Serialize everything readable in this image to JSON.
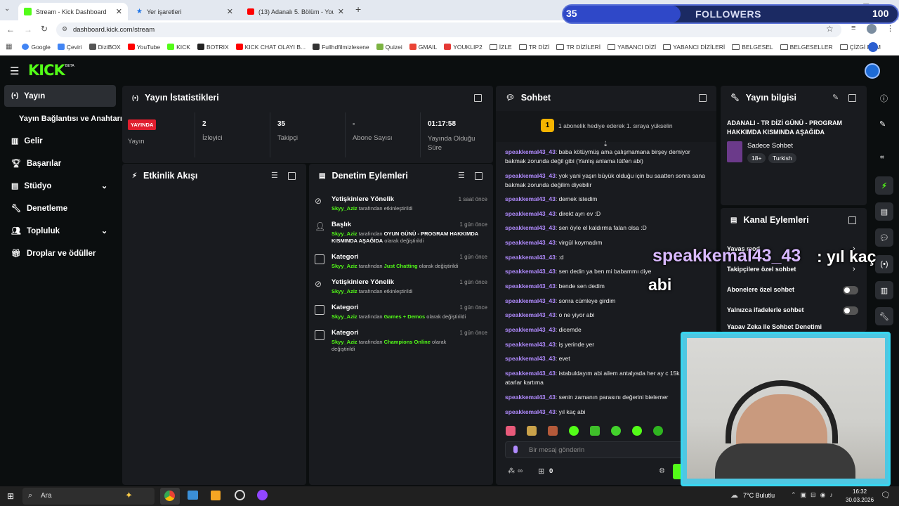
{
  "browser": {
    "tabs": [
      {
        "title": "Stream - Kick Dashboard",
        "active": true
      },
      {
        "title": "Yer işaretleri",
        "active": false
      },
      {
        "title": "(13) Adanalı 5. Bölüm - YouTube",
        "active": false
      }
    ],
    "url": "dashboard.kick.com/stream",
    "bookmarks": [
      "Google",
      "Çeviri",
      "DiziBOX",
      "YouTube",
      "KICK",
      "BOTRIX",
      "KICK CHAT OLAYI B...",
      "Fullhdfilmizlesene",
      "Quizei",
      "GMAIL",
      "YOUKLIP2",
      "İZLE",
      "TR DİZİ",
      "TR DİZİLERİ",
      "YABANCI DİZİ",
      "YABANCI DİZİLERİ",
      "BELGESEL",
      "BELGESELLER",
      "ÇİZGİ FİLM"
    ]
  },
  "overlay": {
    "followers_count": "35",
    "followers_label": "FOLLOWERS",
    "followers_goal": "100",
    "followers_progress": 0.35,
    "caption_user": "speakkemal43_43",
    "caption_text": ": yıl kaç",
    "caption_text2": "abi"
  },
  "logo": "KICK",
  "logo_badge": "BETA",
  "sidebar": {
    "items": [
      {
        "label": "Yayın",
        "icon": "broadcast-icon"
      },
      {
        "label": "Yayın Bağlantısı ve Anahtarı",
        "icon": ""
      },
      {
        "label": "Gelir",
        "icon": "chart-icon"
      },
      {
        "label": "Başarılar",
        "icon": "trophy-icon"
      },
      {
        "label": "Stüdyo",
        "icon": "layout-icon"
      },
      {
        "label": "Denetleme",
        "icon": "wrench-icon"
      },
      {
        "label": "Topluluk",
        "icon": "people-icon"
      },
      {
        "label": "Droplar ve ödüller",
        "icon": "gift-icon"
      }
    ]
  },
  "stats": {
    "title": "Yayın İstatistikleri",
    "live_badge": "YAYINDA",
    "live_label": "Yayın",
    "viewers_value": "2",
    "viewers_label": "İzleyici",
    "followers_value": "35",
    "followers_label": "Takipçi",
    "subs_value": "-",
    "subs_label": "Abone Sayısı",
    "uptime_value": "01:17:58",
    "uptime_label": "Yayında Olduğu Süre"
  },
  "activity": {
    "title": "Etkinlik Akışı"
  },
  "moderation": {
    "title": "Denetim Eylemleri",
    "items": [
      {
        "title": "Yetişkinlere Yönelik",
        "time": "1 saat önce",
        "user": "Skyy_Aziz",
        "pre": " tarafından etkinleştirildi",
        "value": "",
        "post": ""
      },
      {
        "title": "Başlık",
        "time": "1 gün önce",
        "user": "Skyy_Aziz",
        "pre": " tarafından ",
        "value": "OYUN GÜNÜ - PROGRAM HAKKIMDA KISMINDA AŞAĞIDA",
        "post": " olarak değiştirildi"
      },
      {
        "title": "Kategori",
        "time": "1 gün önce",
        "user": "Skyy_Aziz",
        "pre": " tarafından ",
        "value": "Just Chatting",
        "post": " olarak değiştirildi"
      },
      {
        "title": "Yetişkinlere Yönelik",
        "time": "1 gün önce",
        "user": "Skyy_Aziz",
        "pre": " tarafından etkinleştirildi",
        "value": "",
        "post": ""
      },
      {
        "title": "Kategori",
        "time": "1 gün önce",
        "user": "Skyy_Aziz",
        "pre": " tarafından ",
        "value": "Games + Demos",
        "post": " olarak değiştirildi"
      },
      {
        "title": "Kategori",
        "time": "1 gün önce",
        "user": "Skyy_Aziz",
        "pre": " tarafından ",
        "value": "Champions Online",
        "post": " olarak değiştirildi"
      }
    ]
  },
  "chat": {
    "title": "Sohbet",
    "gift_number": "1",
    "gift_text": "1 abonelik hediye ederek 1. sıraya yükselin",
    "messages": [
      {
        "user": "speakkemal43_43",
        "text": ": baba kötüymüş ama çalışmamana birşey demiyor bakmak zorunda değil gibi (Yanlış anlama lütfen abi)"
      },
      {
        "user": "speakkemal43_43",
        "text": ": yok yani yaşın büyük olduğu için bu saatten sonra sana bakmak zorunda değilim diyebilir"
      },
      {
        "user": "speakkemal43_43",
        "text": ": demek istedim"
      },
      {
        "user": "speakkemal43_43",
        "text": ": direkt ayrı ev :D"
      },
      {
        "user": "speakkemal43_43",
        "text": ": sen öyle el kaldırma falan olsa :D"
      },
      {
        "user": "speakkemal43_43",
        "text": ": virgül koymadım"
      },
      {
        "user": "speakkemal43_43",
        "text": ": :d"
      },
      {
        "user": "speakkemal43_43",
        "text": ": sen dedin ya ben mi babammı diye"
      },
      {
        "user": "speakkemal43_43",
        "text": ": bende sen dedim"
      },
      {
        "user": "speakkemal43_43",
        "text": ": sonra cümleye girdim"
      },
      {
        "user": "speakkemal43_43",
        "text": ": o ne yiyor abi"
      },
      {
        "user": "speakkemal43_43",
        "text": ": dicemde"
      },
      {
        "user": "speakkemal43_43",
        "text": ": iş yerinde yer"
      },
      {
        "user": "speakkemal43_43",
        "text": ": evet"
      },
      {
        "user": "speakkemal43_43",
        "text": ": istabuldayım abi ailem antalyada her ay c 15k atarlar kartıma"
      },
      {
        "user": "speakkemal43_43",
        "text": ": senin zamanın parasını değerini bielemer"
      },
      {
        "user": "speakkemal43_43",
        "text": ": yıl kaç abi"
      }
    ],
    "input_placeholder": "Bir mesaj gönderin",
    "points": "0",
    "infinity": "∞"
  },
  "stream_info": {
    "title": "Yayın bilgisi",
    "stream_title": "ADANALI - TR DİZİ GÜNÜ - PROGRAM HAKKIMDA KISMINDA AŞAĞIDA",
    "category": "Sadece Sohbet",
    "tags": [
      "18+",
      "Turkish"
    ]
  },
  "channel_actions": {
    "title": "Kanal Eylemleri",
    "items": [
      {
        "label": "Yavaş mod",
        "kind": "chevron"
      },
      {
        "label": "Takipçilere özel sohbet",
        "kind": "chevron"
      },
      {
        "label": "Abonelere özel sohbet",
        "kind": "toggle"
      },
      {
        "label": "Yalnızca ifadelerle sohbet",
        "kind": "toggle"
      },
      {
        "label": "Yapay Zeka ile Sohbet Denetimi",
        "kind": "chevron"
      }
    ]
  },
  "taskbar": {
    "search": "Ara",
    "weather": "7°C  Bulutlu",
    "time": "16:32",
    "date": "30.03.2026"
  }
}
